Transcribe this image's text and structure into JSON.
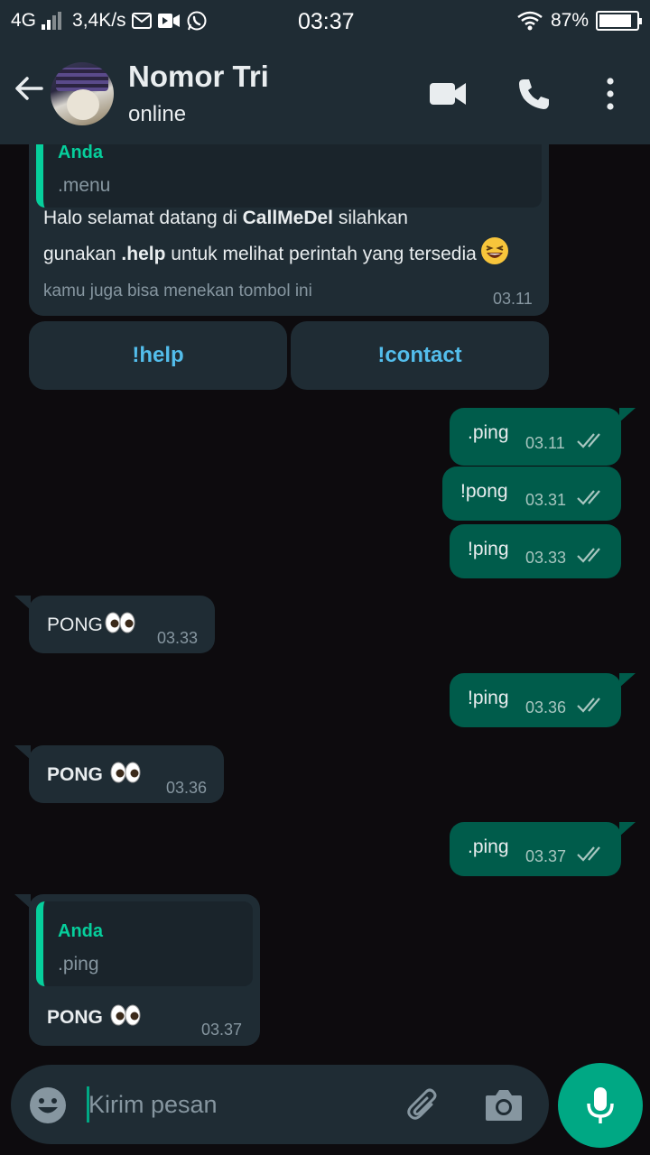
{
  "status_bar": {
    "network": "4G",
    "speed": "3,4K/s",
    "time": "03:37",
    "battery": "87%",
    "battery_level": 0.87
  },
  "header": {
    "contact_name": "Nomor Tri",
    "contact_status": "online"
  },
  "messages": {
    "bot_menu": {
      "quote_author": "Anda",
      "quote_text": ".menu",
      "text_1": "Halo selamat datang di ",
      "text_bold_1": "CallMeDel",
      "text_2": " silahkan",
      "text_3": "gunakan ",
      "text_bold_2": ".help",
      "text_4": " untuk melihat perintah yang tersedia",
      "footer": "kamu juga bisa menekan tombol ini",
      "time": "03.11"
    },
    "buttons": [
      "!help",
      "!contact"
    ],
    "out_1": {
      "text": ".ping",
      "time": "03.11"
    },
    "out_2": {
      "text": "!pong",
      "time": "03.31"
    },
    "out_3": {
      "text": "!ping",
      "time": "03.33"
    },
    "in_1": {
      "text": "PONG",
      "time": "03.33"
    },
    "out_4": {
      "text": "!ping",
      "time": "03.36"
    },
    "in_2": {
      "text": "PONG",
      "time": "03.36"
    },
    "out_5": {
      "text": ".ping",
      "time": "03.37"
    },
    "in_3": {
      "quote_author": "Anda",
      "quote_text": ".ping",
      "text": "PONG",
      "time": "03.37"
    }
  },
  "composer": {
    "placeholder": "Kirim pesan"
  },
  "colors": {
    "bar_bg": "#1f2c34",
    "chat_bg": "#0d0b0e",
    "out_bubble": "#005c4b",
    "accent": "#00a884",
    "link": "#53bdeb"
  }
}
